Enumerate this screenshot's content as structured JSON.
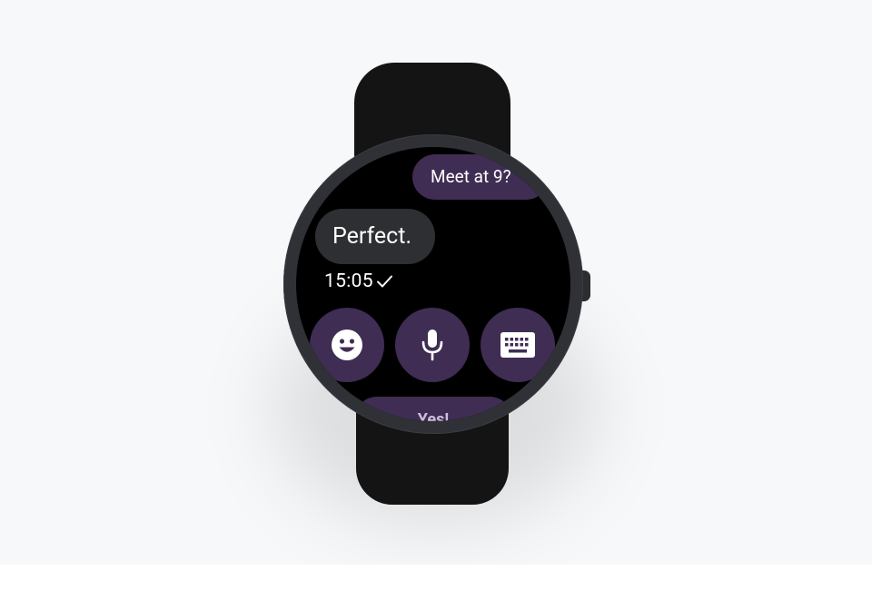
{
  "conversation": {
    "outgoing_message": "Meet at 9?",
    "incoming_message": "Perfect.",
    "timestamp": "15:05",
    "read_status_icon": "checkmark-icon"
  },
  "actions": {
    "emoji_icon": "emoji-icon",
    "voice_icon": "microphone-icon",
    "keyboard_icon": "keyboard-icon"
  },
  "suggested_reply": "Yes!",
  "colors": {
    "background": "#f7f8fa",
    "strap": "#141414",
    "bezel": "#2f3136",
    "screen": "#000000",
    "accent_bubble": "#3f2d54",
    "incoming_bubble": "#2e2f33",
    "text": "#ffffff"
  }
}
